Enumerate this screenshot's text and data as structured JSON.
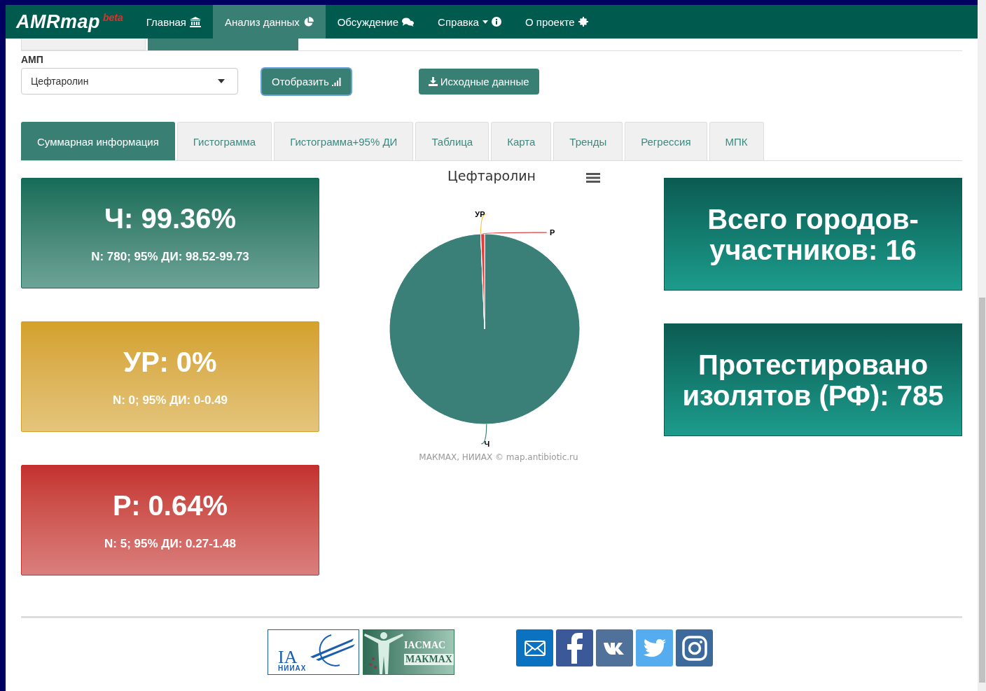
{
  "navbar": {
    "brand": "AMRmap",
    "badge": "beta",
    "items": [
      {
        "label": "Главная",
        "selected": false
      },
      {
        "label": "Анализ данных",
        "selected": true
      },
      {
        "label": "Обсуждение",
        "selected": false
      },
      {
        "label": "Справка",
        "selected": false
      },
      {
        "label": "О проекте",
        "selected": false
      }
    ]
  },
  "upper_tabs": [
    {
      "selected": false
    },
    {
      "selected": true
    }
  ],
  "amp": {
    "label": "АМП",
    "value": "Цефтаролин"
  },
  "buttons": [
    {
      "label": "Отобразить",
      "kind": "primary"
    },
    {
      "label": "Исходные данные",
      "kind": "secondary"
    }
  ],
  "tabs": [
    {
      "label": "Суммарная информация",
      "selected": true
    },
    {
      "label": "Гистограмма",
      "selected": false
    },
    {
      "label": "Гистограмма+95% ДИ",
      "selected": false
    },
    {
      "label": "Таблица",
      "selected": false
    },
    {
      "label": "Карта",
      "selected": false
    },
    {
      "label": "Тренды",
      "selected": false
    },
    {
      "label": "Регрессия",
      "selected": false
    },
    {
      "label": "МПК",
      "selected": false
    }
  ],
  "stat_cards": [
    {
      "title": "Ч: 99.36%",
      "detail": "N: 780; 95% ДИ: 98.52-99.73",
      "color": "#136c58"
    },
    {
      "title": "УР: 0%",
      "detail": "N: 0; 95% ДИ: 0-0.49",
      "color": "#d4a12a"
    },
    {
      "title": "Р: 0.64%",
      "detail": "N: 5; 95% ДИ: 0.27-1.48",
      "color": "#c3302e"
    }
  ],
  "chart": {
    "credits": "МАКМАХ, НИИАХ © map.antibiotic.ru",
    "chart_data": {
      "type": "pie",
      "title": "Цефтаролин",
      "categories": [
        "Ч",
        "УР",
        "Р"
      ],
      "values": [
        99.36,
        0,
        0.64
      ]
    }
  },
  "info_cards": [
    {
      "text": "Всего городов-участников: 16"
    },
    {
      "text": "Протестировано изолятов (РФ): 785"
    }
  ],
  "footer": {
    "logos": [
      {
        "kind": "iac",
        "texts": [
          "IA",
          "НИИАХ"
        ]
      },
      {
        "kind": "iacmac",
        "texts": [
          "IACMAC",
          "МАКМАХ"
        ]
      }
    ],
    "social": [
      {
        "color": "#0a72c0"
      },
      {
        "color": "#3b5998"
      },
      {
        "color": "#50729a"
      },
      {
        "color": "#55acee"
      },
      {
        "color": "#3c6a9c"
      }
    ]
  }
}
